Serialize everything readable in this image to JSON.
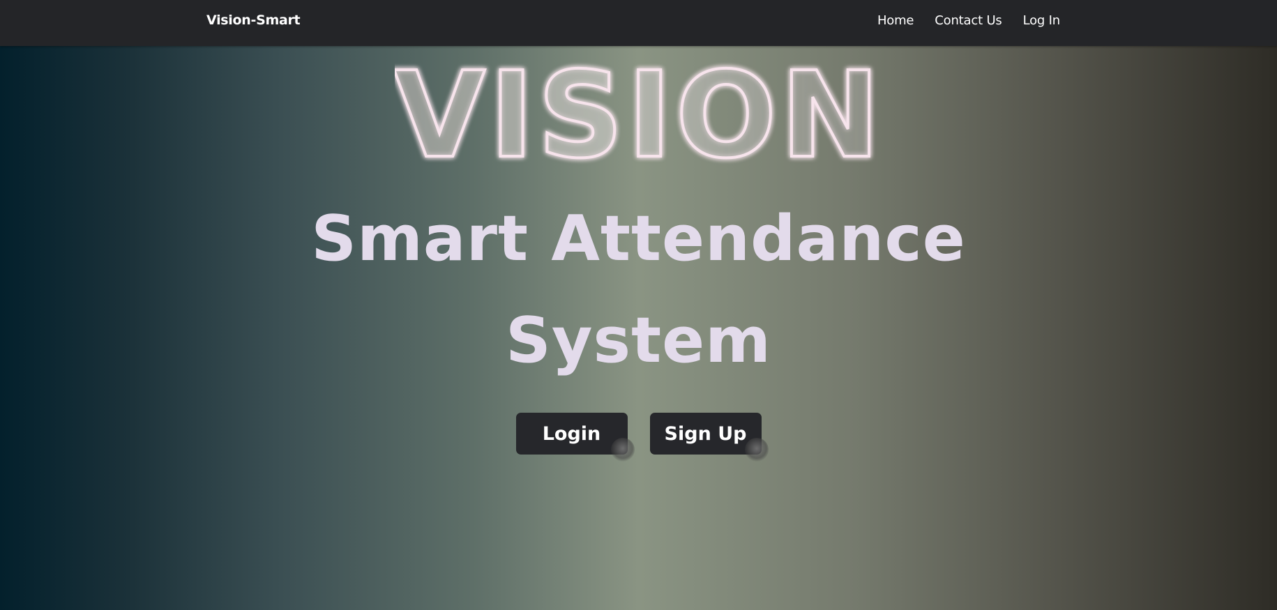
{
  "navbar": {
    "brand": "Vision-Smart",
    "links": [
      {
        "label": "Home"
      },
      {
        "label": "Contact Us"
      },
      {
        "label": "Log In"
      }
    ]
  },
  "hero": {
    "logo_text": "VISION",
    "headline_line1": "Smart Attendance",
    "headline_line2": "System"
  },
  "actions": {
    "login_label": "Login",
    "signup_label": "Sign Up"
  },
  "colors": {
    "navbar_bg": "#242528",
    "headline": "#e3dbeb",
    "button_bg": "#26272b",
    "neon_stroke": "#f7e4ec"
  }
}
